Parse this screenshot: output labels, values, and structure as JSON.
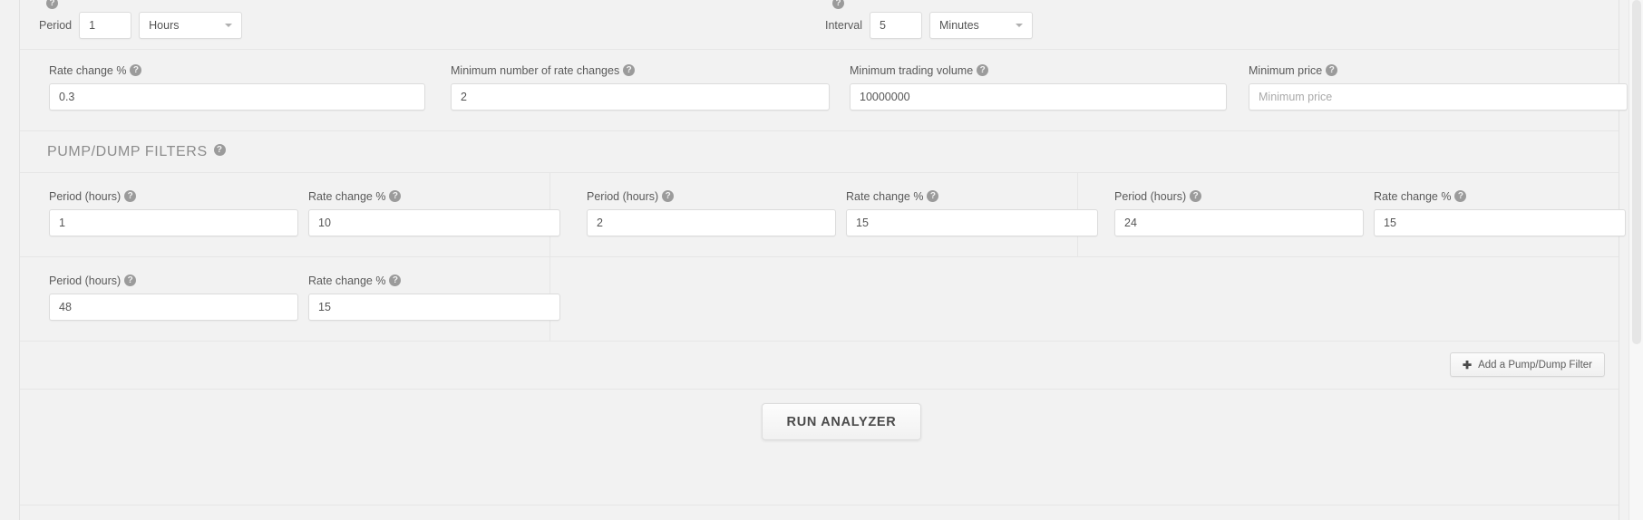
{
  "top_row": {
    "period": {
      "help_icon": "help-icon",
      "label": "Period",
      "value": "1",
      "unit_selected": "Hours",
      "caret_icon": "chevron-down-icon"
    },
    "interval": {
      "help_icon": "help-icon",
      "label": "Interval",
      "value": "5",
      "unit_selected": "Minutes",
      "caret_icon": "chevron-down-icon"
    }
  },
  "main_filters": [
    {
      "label": "Rate change %",
      "value": "0.3",
      "placeholder": "",
      "help_icon": "help-icon"
    },
    {
      "label": "Minimum number of rate changes",
      "value": "2",
      "placeholder": "",
      "help_icon": "help-icon"
    },
    {
      "label": "Minimum trading volume",
      "value": "10000000",
      "placeholder": "",
      "help_icon": "help-icon"
    },
    {
      "label": "Minimum price",
      "value": "",
      "placeholder": "Minimum price",
      "help_icon": "help-icon"
    }
  ],
  "pump_dump": {
    "title": "PUMP/DUMP FILTERS",
    "help_icon": "help-icon",
    "filters": [
      {
        "period_label": "Period (hours)",
        "period_value": "1",
        "rate_label": "Rate change %",
        "rate_value": "10"
      },
      {
        "period_label": "Period (hours)",
        "period_value": "2",
        "rate_label": "Rate change %",
        "rate_value": "15"
      },
      {
        "period_label": "Period (hours)",
        "period_value": "24",
        "rate_label": "Rate change %",
        "rate_value": "15"
      },
      {
        "period_label": "Period (hours)",
        "period_value": "48",
        "rate_label": "Rate change %",
        "rate_value": "15"
      }
    ]
  },
  "add_button": {
    "label": "Add a Pump/Dump Filter",
    "plus_icon": "plus-icon"
  },
  "run_button": {
    "label": "RUN ANALYZER"
  },
  "colors": {
    "page_background": "#f2f2f2",
    "input_border": "#dcdcdc",
    "divider": "#e6e6e6",
    "label_text": "#5a5a5a",
    "title_text": "#8c8c8c",
    "help_icon_bg": "#9b9b9b"
  }
}
